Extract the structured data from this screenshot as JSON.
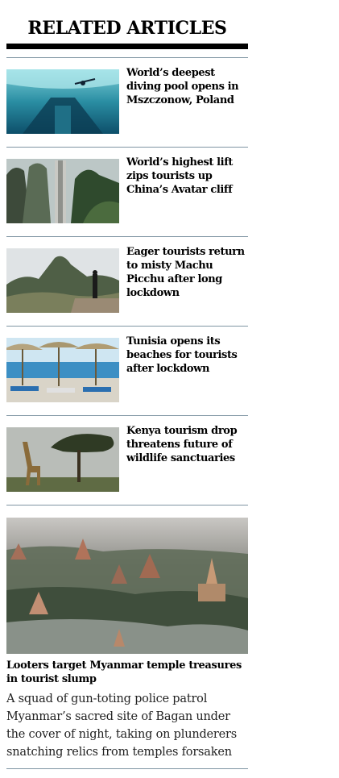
{
  "section": {
    "title": "RELATED ARTICLES"
  },
  "articles": [
    {
      "headline": "World’s deepest diving pool opens in Mszczonow, Poland",
      "image": "diving-pool-photo"
    },
    {
      "headline": "World’s highest lift zips tourists up China’s Avatar cliff",
      "image": "cliff-lift-photo"
    },
    {
      "headline": "Eager tourists return to misty Machu Picchu after long lockdown",
      "image": "machu-picchu-photo"
    },
    {
      "headline": "Tunisia opens its beaches for tourists after lockdown",
      "image": "beach-umbrellas-photo"
    },
    {
      "headline": "Kenya tourism drop threatens future of wildlife sanctuaries",
      "image": "giraffe-photo"
    }
  ],
  "feature": {
    "headline": "Looters target Myanmar temple treasures in tourist slump",
    "summary": "A squad of gun-toting police patrol Myanmar’s sacred site of Bagan under the cover of night, taking on plunderers snatching relics from temples forsaken",
    "image": "bagan-temples-photo"
  },
  "colors": {
    "rule": "#7f95a3",
    "title_bar": "#000000"
  }
}
